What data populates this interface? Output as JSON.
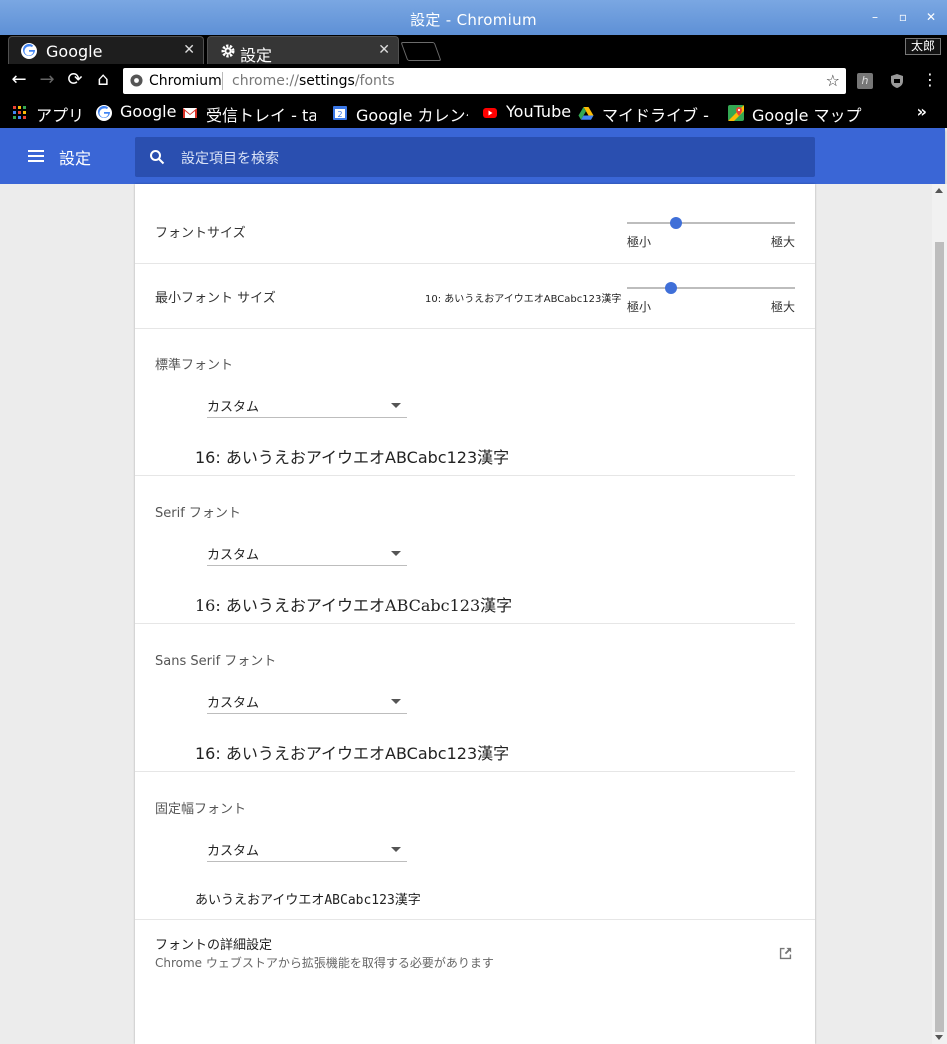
{
  "window": {
    "title": "設定 - Chromium",
    "profile_name": "太郎"
  },
  "tabs": [
    {
      "label": "Google",
      "icon": "google-icon",
      "active": false
    },
    {
      "label": "設定",
      "icon": "gear-icon",
      "active": true
    }
  ],
  "omnibox": {
    "site_name": "Chromium",
    "url_scheme": "chrome://",
    "url_host": "settings",
    "url_path": "/fonts"
  },
  "bookmarks": [
    {
      "label": "アプリ",
      "icon": "apps-grid-icon"
    },
    {
      "label": "Google",
      "icon": "google-icon"
    },
    {
      "label": "受信トレイ - tar",
      "icon": "gmail-icon"
    },
    {
      "label": "Google カレンダ",
      "icon": "calendar-icon"
    },
    {
      "label": "YouTube",
      "icon": "youtube-icon"
    },
    {
      "label": "マイドライブ - G",
      "icon": "drive-icon"
    },
    {
      "label": "Google マップ",
      "icon": "maps-icon"
    }
  ],
  "settings_header": {
    "title": "設定",
    "search_placeholder": "設定項目を検索"
  },
  "fonts": {
    "font_size": {
      "label": "フォントサイズ",
      "min_label": "極小",
      "max_label": "極大",
      "level": 0.29
    },
    "min_font_size": {
      "label": "最小フォント サイズ",
      "sample": "10: あいうえおアイウエオABCabc123漢字",
      "min_label": "極小",
      "max_label": "極大",
      "level": 0.26
    },
    "standard": {
      "title": "標準フォント",
      "select": "カスタム",
      "sample": "16: あいうえおアイウエオABCabc123漢字"
    },
    "serif": {
      "title": "Serif フォント",
      "select": "カスタム",
      "sample": "16: あいうえおアイウエオABCabc123漢字"
    },
    "sans_serif": {
      "title": "Sans Serif フォント",
      "select": "カスタム",
      "sample": "16: あいうえおアイウエオABCabc123漢字"
    },
    "fixed": {
      "title": "固定幅フォント",
      "select": "カスタム",
      "sample": "あいうえおアイウエオABCabc123漢字"
    },
    "advanced": {
      "title": "フォントの詳細設定",
      "subtitle": "Chrome ウェブストアから拡張機能を取得する必要があります"
    }
  },
  "colors": {
    "settings_blue": "#3a66d6",
    "search_blue": "#2a4fb0",
    "slider_knob": "#3f6fd8"
  }
}
